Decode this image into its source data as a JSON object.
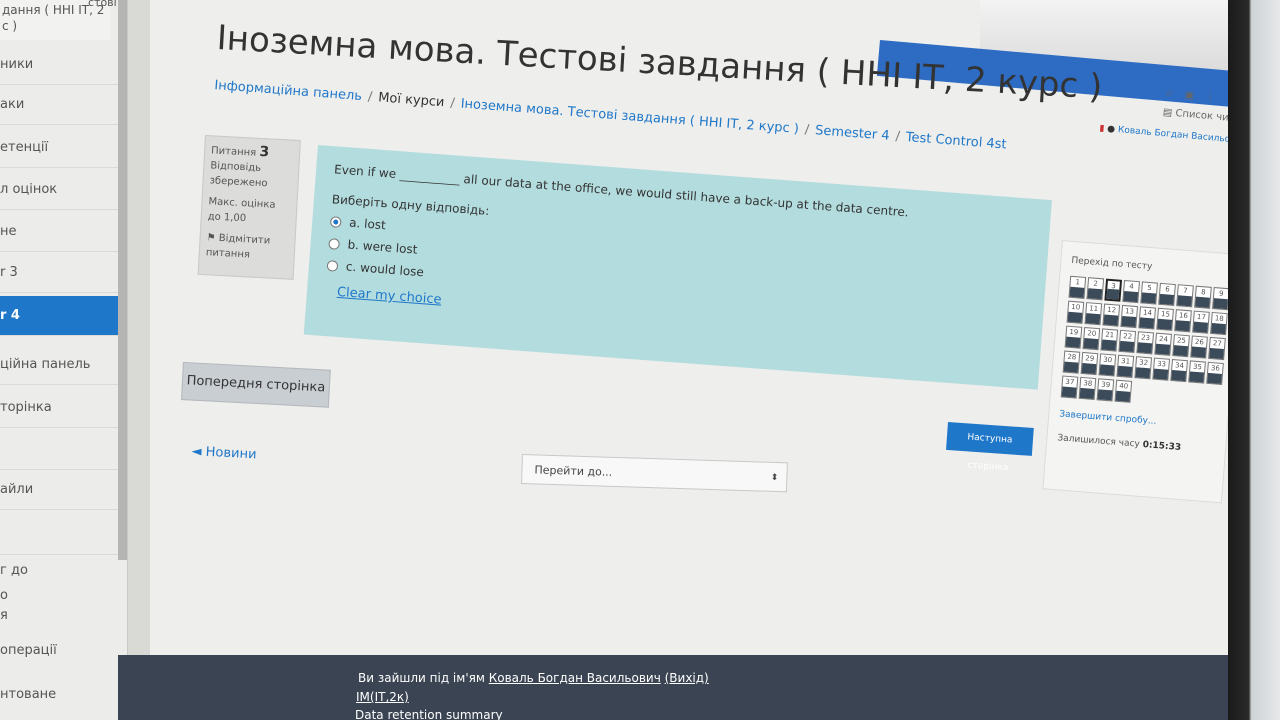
{
  "sidebar": {
    "top_line1": "дання ( ННІ ІТ, 2",
    "top_line2": "с )",
    "top_corner": "стові",
    "items": [
      {
        "label": "ники"
      },
      {
        "label": "аки"
      },
      {
        "label": "етенції"
      },
      {
        "label": "л оцінок"
      },
      {
        "label": "не"
      },
      {
        "label": "r 3"
      },
      {
        "label": "r 4",
        "active": true
      },
      {
        "label": "ційна панель"
      },
      {
        "label": "торінка"
      },
      {
        "label": ""
      },
      {
        "label": "айли"
      },
      {
        "label": ""
      },
      {
        "label": "г до"
      },
      {
        "label": "о"
      },
      {
        "label": "я"
      },
      {
        "label": "операції"
      },
      {
        "label": "нтоване"
      }
    ]
  },
  "header": {
    "title": "Іноземна мова. Тестові завдання ( ННІ ІТ, 2 курс )",
    "breadcrumb": [
      {
        "label": "Інформаційна панель"
      },
      {
        "label": "Мої курси"
      },
      {
        "label": "Іноземна мова. Тестові завдання ( ННІ ІТ, 2 курс )"
      },
      {
        "label": "Semester 4"
      },
      {
        "label": "Test Control 4st"
      }
    ]
  },
  "user": {
    "name": "Коваль Богдан Васильович",
    "browser_text": "Список читання"
  },
  "question_info": {
    "label": "Питання",
    "number": "3",
    "status": "Відповідь збережено",
    "max_grade": "Макс. оцінка до 1,00",
    "flag": "Відмітити питання"
  },
  "question": {
    "text_before": "Even if we",
    "blank": "__________",
    "text_after": "all our data at the office, we would still have a back-up at the data centre.",
    "prompt": "Виберіть одну відповідь:",
    "options": [
      {
        "label": "a. lost",
        "checked": true
      },
      {
        "label": "b. were lost",
        "checked": false
      },
      {
        "label": "c. would lose",
        "checked": false
      }
    ],
    "clear": "Clear my choice"
  },
  "nav": {
    "prev": "Попередня сторінка",
    "next": "Наступна сторінка",
    "news": "◄ Новини",
    "jump_placeholder": "Перейти до...",
    "jump_arrow": "⬍"
  },
  "quiz_nav": {
    "title": "Перехід по тесту",
    "questions": [
      "1",
      "2",
      "3",
      "4",
      "5",
      "6",
      "7",
      "8",
      "9",
      "10",
      "11",
      "12",
      "13",
      "14",
      "15",
      "16",
      "17",
      "18",
      "19",
      "20",
      "21",
      "22",
      "23",
      "24",
      "25",
      "26",
      "27",
      "28",
      "29",
      "30",
      "31",
      "32",
      "33",
      "34",
      "35",
      "36",
      "37",
      "38",
      "39",
      "40"
    ],
    "current": "3",
    "finish": "Завершити спробу...",
    "time_label": "Залишилося часу",
    "time_value": "0:15:33"
  },
  "footer": {
    "logged_in_prefix": "Ви зайшли під ім'ям",
    "user_name": "Коваль Богдан Васильович",
    "logout": "(Вихід)",
    "group": "ІМ(ІТ,2к)",
    "retention": "Data retention summary"
  },
  "colors": {
    "accent": "#1f77c9",
    "question_bg": "#b3dcde",
    "footer_bg": "#3a4452",
    "nav_bar": "#3c4b5a"
  }
}
